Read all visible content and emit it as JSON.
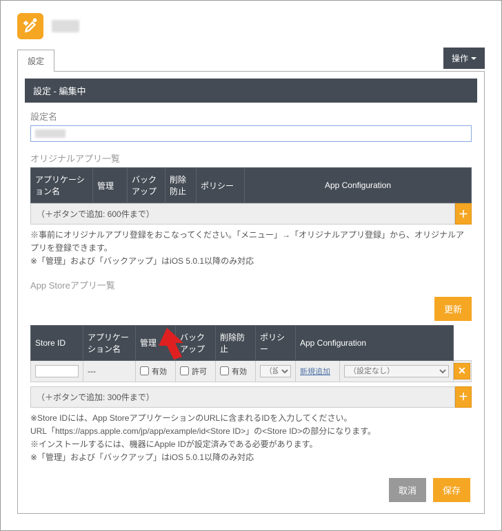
{
  "header": {
    "logo_label": ""
  },
  "tabs": {
    "settings": "設定"
  },
  "ops_menu": "操作",
  "panel_title": "設定 - 編集中",
  "setting_name": {
    "label": "設定名",
    "value": ""
  },
  "original_apps": {
    "section_label": "オリジナルアプリ一覧",
    "headers": {
      "app_name": "アプリケーション名",
      "manage": "管理",
      "backup": "バックアップ",
      "prevent_delete": "削除防止",
      "policy": "ポリシー",
      "app_config": "App Configuration"
    },
    "add_hint": "（＋ボタンで追加: 600件まで）",
    "note": "※事前にオリジナルアプリ登録をおこなってください。「メニュー」→「オリジナルアプリ登録」から、オリジナルアプリを登録できます。\n※「管理」および「バックアップ」はiOS 5.0.1以降のみ対応"
  },
  "appstore_apps": {
    "section_label": "App Storeアプリ一覧",
    "update_btn": "更新",
    "headers": {
      "store_id": "Store ID",
      "app_name": "アプリケーション名",
      "manage": "管理",
      "backup": "バックアップ",
      "prevent_delete": "削除防止",
      "policy": "ポリシー",
      "app_config": "App Configuration"
    },
    "row": {
      "store_id_value": "",
      "app_name": "---",
      "manage_label": "有効",
      "backup_label": "許可",
      "prevent_label": "有効",
      "policy_select": "（設定）",
      "app_config_link": "新規追加",
      "app_config_select": "（設定なし）"
    },
    "add_hint": "（＋ボタンで追加: 300件まで）",
    "note": "※Store IDには、App StoreアプリケーションのURLに含まれるIDを入力してください。\nURL「https://apps.apple.com/jp/app/example/id<Store ID>」の<Store ID>の部分になります。\n※インストールするには、機器にApple IDが設定済みである必要があります。\n※「管理」および「バックアップ」はiOS 5.0.1以降のみ対応"
  },
  "actions": {
    "cancel": "取消",
    "save": "保存"
  }
}
